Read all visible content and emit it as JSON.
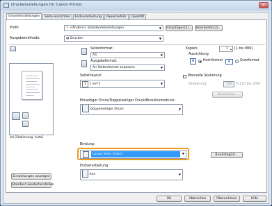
{
  "window": {
    "title": "Druckeinstellungen für Canon Printer"
  },
  "tabs": [
    "Grundeinstellungen",
    "Seite einrichten",
    "Endverarbeitung",
    "Papierzufuhr",
    "Qualität"
  ],
  "profile": {
    "label": "Profil:",
    "value": "<Ändern> Standardeinstellungen",
    "add_button": "Hinzufügen(1)...",
    "edit_button": "Bearbeiten(2)..."
  },
  "output": {
    "label": "Ausgabemethode:",
    "value": "Drucken"
  },
  "preview": {
    "caption": "A4 [Skalierung: Auto]"
  },
  "page_size": {
    "label": "Seitenformat:",
    "value": "A4"
  },
  "output_size": {
    "label": "Ausgabeformat:",
    "value": "An Seitenformat anpassen"
  },
  "copies": {
    "label": "Kopien:",
    "value": "1",
    "range": "[1 bis 999]"
  },
  "orientation": {
    "label": "Ausrichtung",
    "portrait": "Hochformat",
    "landscape": "Querformat",
    "selected": "portrait"
  },
  "page_layout": {
    "label": "Seitenlayout:",
    "value": "1 auf 1"
  },
  "manual_scaling": {
    "label": "Manuelle Skalierung",
    "scale_label": "Skalierung:",
    "value": "100",
    "range": "% [25 bis 200]"
  },
  "booklet_button": "Broschüre...",
  "duplex": {
    "label": "Einseitiger Druck/Doppelseitiger Druck/Broschürendruck:",
    "value": "Doppelseitiger Druck"
  },
  "binding": {
    "label": "Bindung:",
    "value": "Lange Seite [links]",
    "button": "Bundsteg(U)..."
  },
  "finishing": {
    "label": "Endverarbeitung:",
    "value": "Aus"
  },
  "left_buttons": {
    "show_settings": "Einstellungen anzeigen",
    "restore": "Standard wiederherstellen"
  },
  "footer": {
    "ok": "OK",
    "cancel": "Abbrechen",
    "apply": "Übernehmen",
    "help": "Hilfe"
  }
}
